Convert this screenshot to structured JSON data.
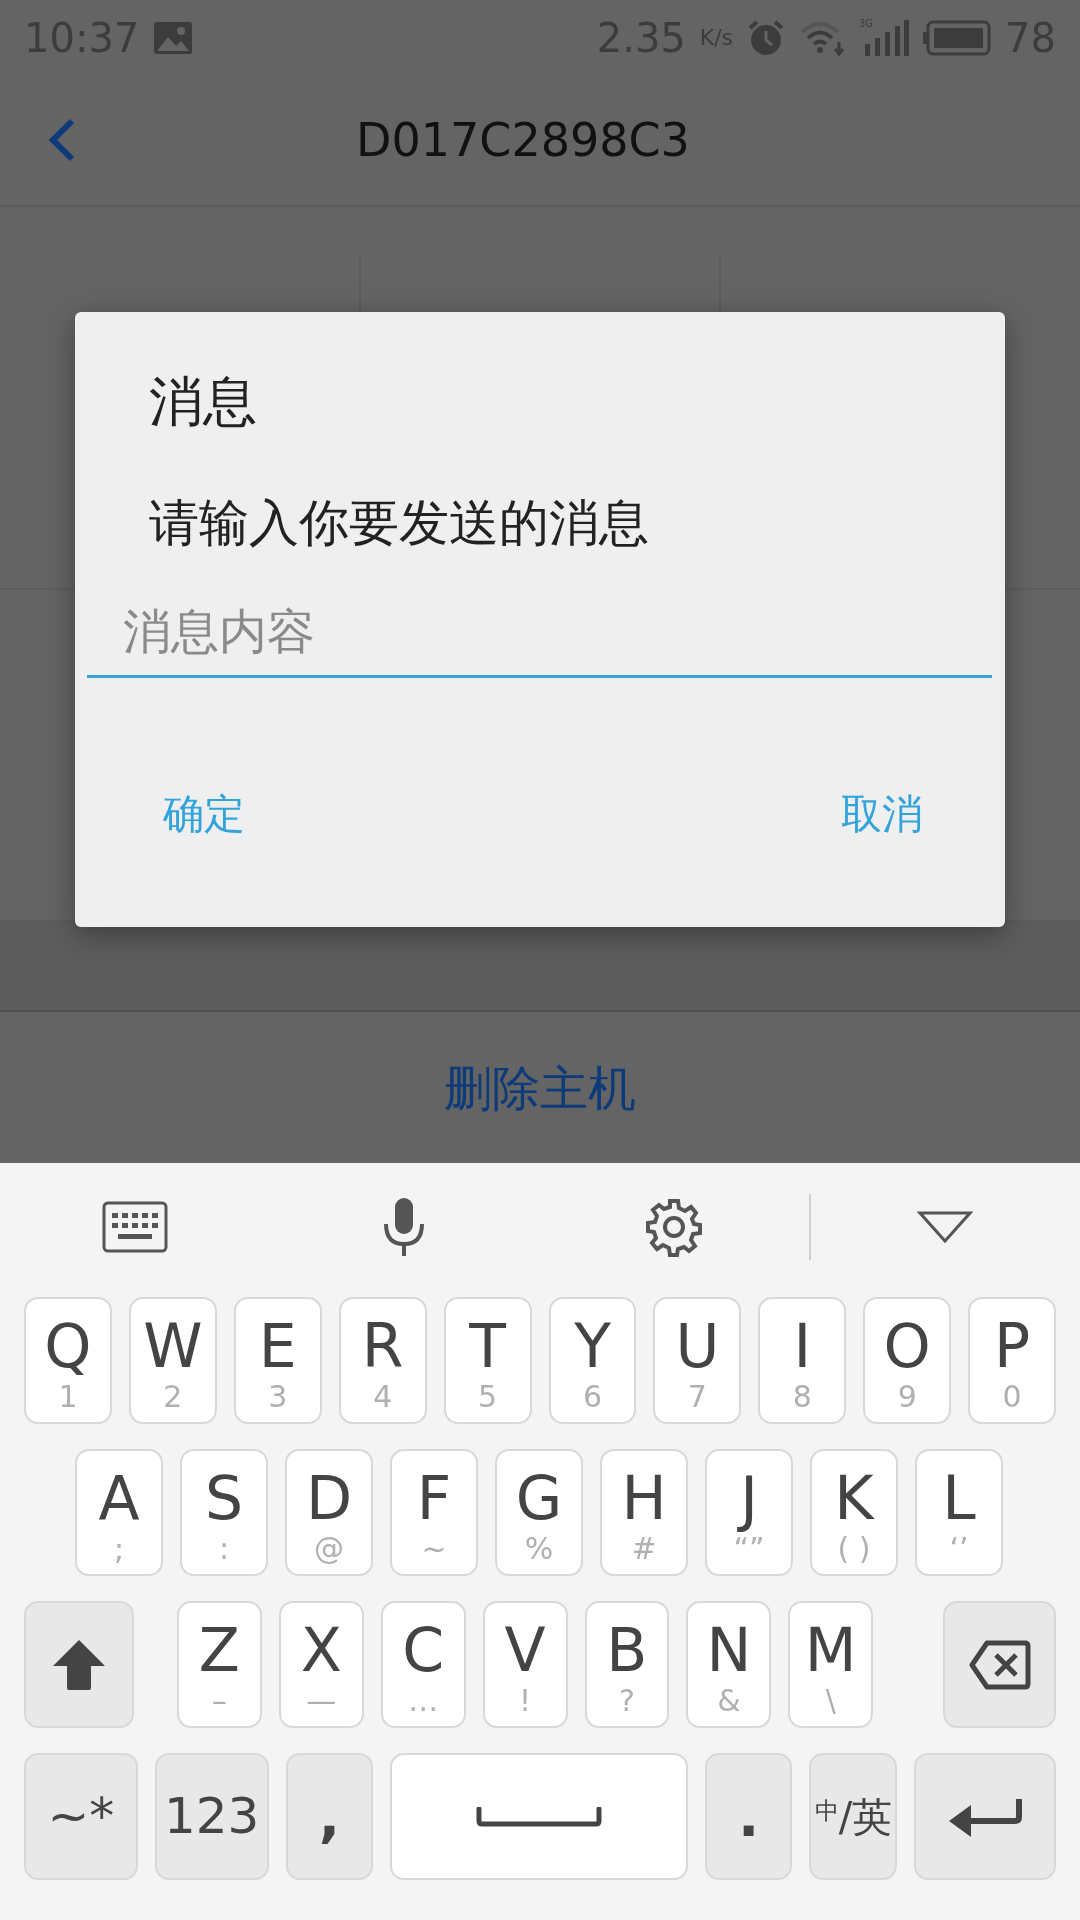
{
  "status_bar": {
    "time": "10:37",
    "net_speed": "2.35",
    "net_unit": "K/s",
    "network_type": "3G",
    "battery": "78"
  },
  "app_bar": {
    "title": "D017C2898C3"
  },
  "background": {
    "action": "删除主机"
  },
  "dialog": {
    "title": "消息",
    "message": "请输入你要发送的消息",
    "input": {
      "placeholder": "消息内容"
    },
    "buttons": [
      {
        "label": "确定"
      },
      {
        "label": "取消"
      }
    ]
  },
  "keyboard": {
    "rows": [
      {
        "keys": [
          {
            "kind": "letter",
            "label": "Q",
            "hint": "1"
          },
          {
            "kind": "letter",
            "label": "W",
            "hint": "2"
          },
          {
            "kind": "letter",
            "label": "E",
            "hint": "3"
          },
          {
            "kind": "letter",
            "label": "R",
            "hint": "4"
          },
          {
            "kind": "letter",
            "label": "T",
            "hint": "5"
          },
          {
            "kind": "letter",
            "label": "Y",
            "hint": "6"
          },
          {
            "kind": "letter",
            "label": "U",
            "hint": "7"
          },
          {
            "kind": "letter",
            "label": "I",
            "hint": "8"
          },
          {
            "kind": "letter",
            "label": "O",
            "hint": "9"
          },
          {
            "kind": "letter",
            "label": "P",
            "hint": "0"
          }
        ]
      },
      {
        "keys": [
          {
            "kind": "letter",
            "label": "A",
            "hint": ";"
          },
          {
            "kind": "letter",
            "label": "S",
            "hint": ":"
          },
          {
            "kind": "letter",
            "label": "D",
            "hint": "@"
          },
          {
            "kind": "letter",
            "label": "F",
            "hint": "~"
          },
          {
            "kind": "letter",
            "label": "G",
            "hint": "%"
          },
          {
            "kind": "letter",
            "label": "H",
            "hint": "#"
          },
          {
            "kind": "letter",
            "label": "J",
            "hint": "“”"
          },
          {
            "kind": "letter",
            "label": "K",
            "hint": "( )"
          },
          {
            "kind": "letter",
            "label": "L",
            "hint": "‘’"
          }
        ]
      },
      {
        "keys": [
          {
            "kind": "shift"
          },
          {
            "kind": "letter",
            "label": "Z",
            "hint": "–"
          },
          {
            "kind": "letter",
            "label": "X",
            "hint": "—"
          },
          {
            "kind": "letter",
            "label": "C",
            "hint": "…"
          },
          {
            "kind": "letter",
            "label": "V",
            "hint": "!"
          },
          {
            "kind": "letter",
            "label": "B",
            "hint": "?"
          },
          {
            "kind": "letter",
            "label": "N",
            "hint": "&"
          },
          {
            "kind": "letter",
            "label": "M",
            "hint": "\\"
          },
          {
            "kind": "backspace"
          }
        ]
      },
      {
        "keys": [
          {
            "kind": "mode",
            "label": "~*"
          },
          {
            "kind": "mode",
            "label": "123"
          },
          {
            "kind": "punct",
            "label": ","
          },
          {
            "kind": "space"
          },
          {
            "kind": "punct",
            "label": "."
          },
          {
            "kind": "lang",
            "label": "$^{中}$/英"
          },
          {
            "kind": "enter"
          }
        ]
      }
    ]
  }
}
